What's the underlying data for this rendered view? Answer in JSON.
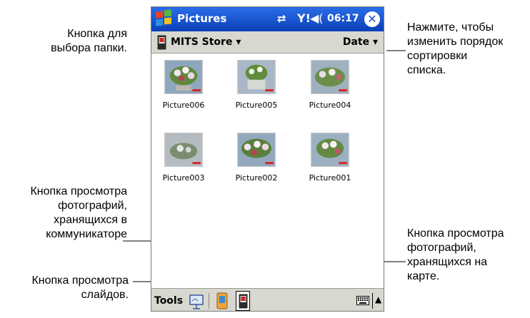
{
  "callouts": {
    "folder": [
      "Кнопка для",
      "выбора папки."
    ],
    "sort": [
      "Нажмите, чтобы",
      "изменить порядок",
      "сортировки",
      "списка."
    ],
    "device_photos": [
      "Кнопка просмотра",
      "фотографий,",
      "хранящихся в",
      "коммуникаторе"
    ],
    "slides": [
      "Кнопка просмотра",
      "слайдов."
    ],
    "card_photos": [
      "Кнопка просмотра",
      "фотографий,",
      "хранящихся на",
      "карте."
    ]
  },
  "titlebar": {
    "title": "Pictures",
    "sync": "⇄",
    "signal": "Y!",
    "volume": "◀(",
    "time": "06:17",
    "close": "✕",
    "bg_color": "#1a4fc8"
  },
  "folderbar": {
    "folder": "MITS Store ▾",
    "sort": "Date ▾"
  },
  "pictures": [
    {
      "name": "Picture006"
    },
    {
      "name": "Picture005"
    },
    {
      "name": "Picture004"
    },
    {
      "name": "Picture003"
    },
    {
      "name": "Picture002"
    },
    {
      "name": "Picture001"
    }
  ],
  "bottombar": {
    "tools": "Tools",
    "sip": "▲"
  },
  "icons": {
    "start": "windows-flag-icon",
    "slideshow": "slideshow-icon",
    "device": "device-memory-icon",
    "card": "storage-card-icon",
    "keyboard": "keyboard-icon"
  }
}
